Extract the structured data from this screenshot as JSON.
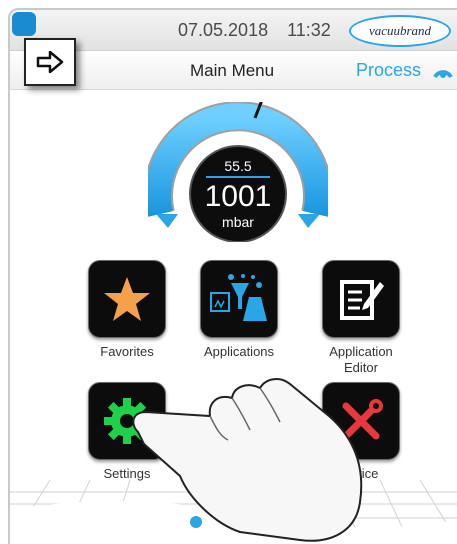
{
  "status_bar": {
    "date": "07.05.2018",
    "time": "11:32",
    "brand": "vacuubrand"
  },
  "header": {
    "title": "Main Menu",
    "process_label": "Process"
  },
  "gauge": {
    "setpoint": "55.5",
    "value": "1001",
    "unit": "mbar"
  },
  "menu": {
    "favorites": "Favorites",
    "applications": "Applications",
    "application_editor_line1": "Application",
    "application_editor_line2": "Editor",
    "settings": "Settings",
    "service": "ervice"
  },
  "colors": {
    "accent": "#2aa6e6",
    "tile_bg": "#0c0c0c",
    "star": "#f5a04a",
    "gear": "#1fd04a",
    "service": "#e8383d"
  },
  "icons": [
    "arrow-right-icon",
    "process-icon",
    "star-icon",
    "applications-icon",
    "editor-icon",
    "gear-icon",
    "tools-icon",
    "hand-icon"
  ]
}
